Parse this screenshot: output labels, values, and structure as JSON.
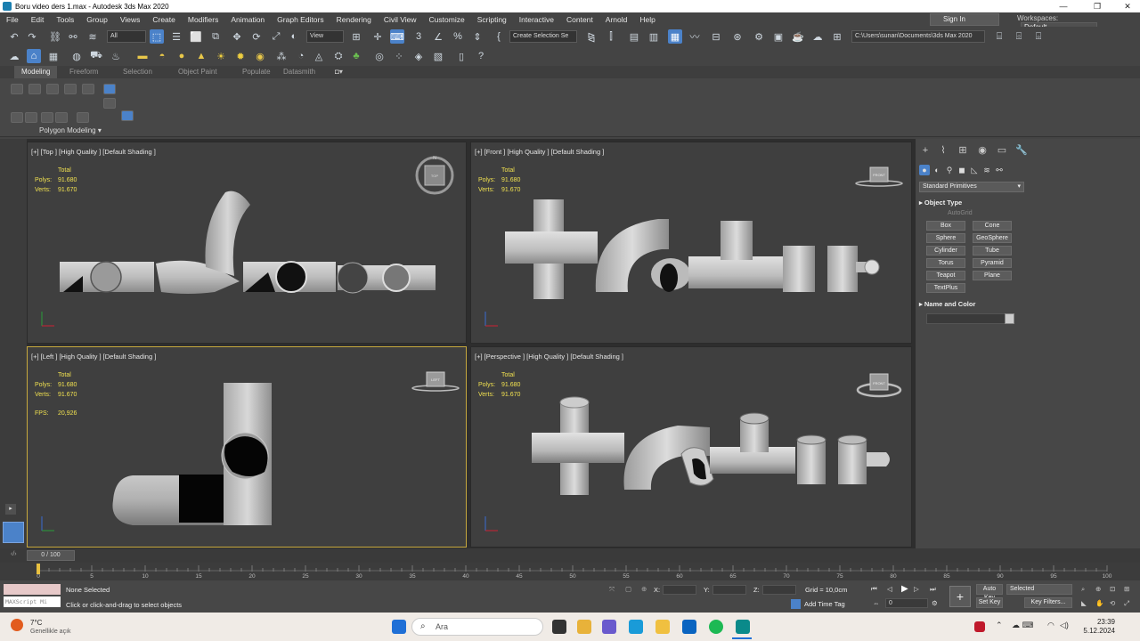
{
  "window": {
    "title": "Boru video ders 1.max - Autodesk 3ds Max 2020"
  },
  "menu": [
    "File",
    "Edit",
    "Tools",
    "Group",
    "Views",
    "Create",
    "Modifiers",
    "Animation",
    "Graph Editors",
    "Rendering",
    "Civil View",
    "Customize",
    "Scripting",
    "Interactive",
    "Content",
    "Arnold",
    "Help"
  ],
  "account": {
    "signin": "Sign In",
    "workspaces_label": "Workspaces:",
    "workspaces_value": "Default"
  },
  "toolbar": {
    "filter": "All",
    "refcoord": "View",
    "selection_set": "Create Selection Se",
    "project_path": "C:\\Users\\sunan\\Documents\\3ds Max 2020"
  },
  "ribbon": {
    "tabs": [
      "Modeling",
      "Freeform",
      "Selection",
      "Object Paint",
      "Populate",
      "Datasmith"
    ],
    "panel_label": "Polygon Modeling"
  },
  "viewports": [
    {
      "header": "[+] [Top ] [High Quality ] [Default Shading ]",
      "gizmo": "TOP",
      "total": "Total",
      "polys_label": "Polys:",
      "polys": "91.680",
      "verts_label": "Verts:",
      "verts": "91.670"
    },
    {
      "header": "[+] [Front ] [High Quality ] [Default Shading ]",
      "gizmo": "FRONT",
      "total": "Total",
      "polys_label": "Polys:",
      "polys": "91.680",
      "verts_label": "Verts:",
      "verts": "91.670"
    },
    {
      "header": "[+] [Left ] [High Quality ] [Default Shading ]",
      "gizmo": "LEFT",
      "total": "Total",
      "polys_label": "Polys:",
      "polys": "91.680",
      "verts_label": "Verts:",
      "verts": "91.670",
      "fps_label": "FPS:",
      "fps": "20,926"
    },
    {
      "header": "[+] [Perspective ] [High Quality ] [Default Shading ]",
      "gizmo": "FRONT",
      "total": "Total",
      "polys_label": "Polys:",
      "polys": "91.680",
      "verts_label": "Verts:",
      "verts": "91.670"
    }
  ],
  "command_panel": {
    "dropdown": "Standard Primitives",
    "object_type_title": "Object Type",
    "autogrid": "AutoGrid",
    "buttons": [
      "Box",
      "Cone",
      "Sphere",
      "GeoSphere",
      "Cylinder",
      "Tube",
      "Torus",
      "Pyramid",
      "Teapot",
      "Plane",
      "TextPlus"
    ],
    "name_color_title": "Name and Color"
  },
  "timeline": {
    "frame_display": "0 / 100",
    "ticks": [
      "0",
      "5",
      "10",
      "15",
      "20",
      "25",
      "30",
      "35",
      "40",
      "45",
      "50",
      "55",
      "60",
      "65",
      "70",
      "75",
      "80",
      "85",
      "90",
      "95",
      "100"
    ]
  },
  "status": {
    "maxscript": "MAXScript Mi",
    "selection": "None Selected",
    "prompt": "Click or click-and-drag to select objects",
    "x_label": "X:",
    "y_label": "Y:",
    "z_label": "Z:",
    "grid": "Grid = 10,0cm",
    "add_time_tag": "Add Time Tag",
    "frame_value": "0",
    "auto_key": "Auto Key",
    "selected": "Selected",
    "set_key": "Set Key",
    "key_filters": "Key Filters..."
  },
  "taskbar": {
    "temperature": "7°C",
    "weather": "Genellikle açık",
    "search": "Ara",
    "time": "23:39",
    "date": "5.12.2024"
  }
}
